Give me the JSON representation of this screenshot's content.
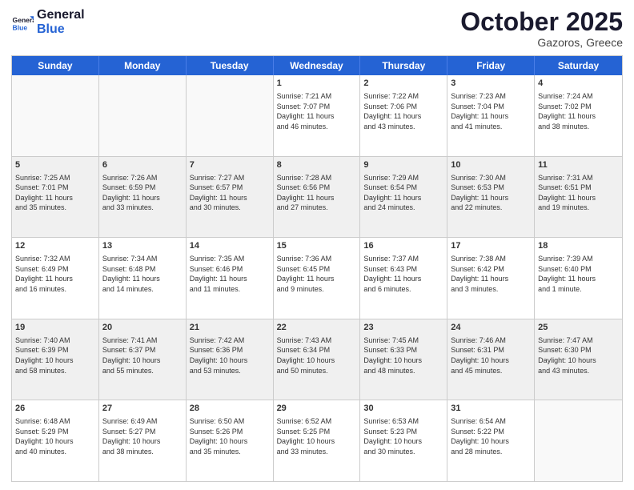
{
  "header": {
    "logo_general": "General",
    "logo_blue": "Blue",
    "month_title": "October 2025",
    "subtitle": "Gazoros, Greece"
  },
  "days_of_week": [
    "Sunday",
    "Monday",
    "Tuesday",
    "Wednesday",
    "Thursday",
    "Friday",
    "Saturday"
  ],
  "rows": [
    {
      "shaded": false,
      "cells": [
        {
          "day": "",
          "empty": true,
          "lines": []
        },
        {
          "day": "",
          "empty": true,
          "lines": []
        },
        {
          "day": "",
          "empty": true,
          "lines": []
        },
        {
          "day": "1",
          "empty": false,
          "lines": [
            "Sunrise: 7:21 AM",
            "Sunset: 7:07 PM",
            "Daylight: 11 hours",
            "and 46 minutes."
          ]
        },
        {
          "day": "2",
          "empty": false,
          "lines": [
            "Sunrise: 7:22 AM",
            "Sunset: 7:06 PM",
            "Daylight: 11 hours",
            "and 43 minutes."
          ]
        },
        {
          "day": "3",
          "empty": false,
          "lines": [
            "Sunrise: 7:23 AM",
            "Sunset: 7:04 PM",
            "Daylight: 11 hours",
            "and 41 minutes."
          ]
        },
        {
          "day": "4",
          "empty": false,
          "lines": [
            "Sunrise: 7:24 AM",
            "Sunset: 7:02 PM",
            "Daylight: 11 hours",
            "and 38 minutes."
          ]
        }
      ]
    },
    {
      "shaded": true,
      "cells": [
        {
          "day": "5",
          "empty": false,
          "lines": [
            "Sunrise: 7:25 AM",
            "Sunset: 7:01 PM",
            "Daylight: 11 hours",
            "and 35 minutes."
          ]
        },
        {
          "day": "6",
          "empty": false,
          "lines": [
            "Sunrise: 7:26 AM",
            "Sunset: 6:59 PM",
            "Daylight: 11 hours",
            "and 33 minutes."
          ]
        },
        {
          "day": "7",
          "empty": false,
          "lines": [
            "Sunrise: 7:27 AM",
            "Sunset: 6:57 PM",
            "Daylight: 11 hours",
            "and 30 minutes."
          ]
        },
        {
          "day": "8",
          "empty": false,
          "lines": [
            "Sunrise: 7:28 AM",
            "Sunset: 6:56 PM",
            "Daylight: 11 hours",
            "and 27 minutes."
          ]
        },
        {
          "day": "9",
          "empty": false,
          "lines": [
            "Sunrise: 7:29 AM",
            "Sunset: 6:54 PM",
            "Daylight: 11 hours",
            "and 24 minutes."
          ]
        },
        {
          "day": "10",
          "empty": false,
          "lines": [
            "Sunrise: 7:30 AM",
            "Sunset: 6:53 PM",
            "Daylight: 11 hours",
            "and 22 minutes."
          ]
        },
        {
          "day": "11",
          "empty": false,
          "lines": [
            "Sunrise: 7:31 AM",
            "Sunset: 6:51 PM",
            "Daylight: 11 hours",
            "and 19 minutes."
          ]
        }
      ]
    },
    {
      "shaded": false,
      "cells": [
        {
          "day": "12",
          "empty": false,
          "lines": [
            "Sunrise: 7:32 AM",
            "Sunset: 6:49 PM",
            "Daylight: 11 hours",
            "and 16 minutes."
          ]
        },
        {
          "day": "13",
          "empty": false,
          "lines": [
            "Sunrise: 7:34 AM",
            "Sunset: 6:48 PM",
            "Daylight: 11 hours",
            "and 14 minutes."
          ]
        },
        {
          "day": "14",
          "empty": false,
          "lines": [
            "Sunrise: 7:35 AM",
            "Sunset: 6:46 PM",
            "Daylight: 11 hours",
            "and 11 minutes."
          ]
        },
        {
          "day": "15",
          "empty": false,
          "lines": [
            "Sunrise: 7:36 AM",
            "Sunset: 6:45 PM",
            "Daylight: 11 hours",
            "and 9 minutes."
          ]
        },
        {
          "day": "16",
          "empty": false,
          "lines": [
            "Sunrise: 7:37 AM",
            "Sunset: 6:43 PM",
            "Daylight: 11 hours",
            "and 6 minutes."
          ]
        },
        {
          "day": "17",
          "empty": false,
          "lines": [
            "Sunrise: 7:38 AM",
            "Sunset: 6:42 PM",
            "Daylight: 11 hours",
            "and 3 minutes."
          ]
        },
        {
          "day": "18",
          "empty": false,
          "lines": [
            "Sunrise: 7:39 AM",
            "Sunset: 6:40 PM",
            "Daylight: 11 hours",
            "and 1 minute."
          ]
        }
      ]
    },
    {
      "shaded": true,
      "cells": [
        {
          "day": "19",
          "empty": false,
          "lines": [
            "Sunrise: 7:40 AM",
            "Sunset: 6:39 PM",
            "Daylight: 10 hours",
            "and 58 minutes."
          ]
        },
        {
          "day": "20",
          "empty": false,
          "lines": [
            "Sunrise: 7:41 AM",
            "Sunset: 6:37 PM",
            "Daylight: 10 hours",
            "and 55 minutes."
          ]
        },
        {
          "day": "21",
          "empty": false,
          "lines": [
            "Sunrise: 7:42 AM",
            "Sunset: 6:36 PM",
            "Daylight: 10 hours",
            "and 53 minutes."
          ]
        },
        {
          "day": "22",
          "empty": false,
          "lines": [
            "Sunrise: 7:43 AM",
            "Sunset: 6:34 PM",
            "Daylight: 10 hours",
            "and 50 minutes."
          ]
        },
        {
          "day": "23",
          "empty": false,
          "lines": [
            "Sunrise: 7:45 AM",
            "Sunset: 6:33 PM",
            "Daylight: 10 hours",
            "and 48 minutes."
          ]
        },
        {
          "day": "24",
          "empty": false,
          "lines": [
            "Sunrise: 7:46 AM",
            "Sunset: 6:31 PM",
            "Daylight: 10 hours",
            "and 45 minutes."
          ]
        },
        {
          "day": "25",
          "empty": false,
          "lines": [
            "Sunrise: 7:47 AM",
            "Sunset: 6:30 PM",
            "Daylight: 10 hours",
            "and 43 minutes."
          ]
        }
      ]
    },
    {
      "shaded": false,
      "cells": [
        {
          "day": "26",
          "empty": false,
          "lines": [
            "Sunrise: 6:48 AM",
            "Sunset: 5:29 PM",
            "Daylight: 10 hours",
            "and 40 minutes."
          ]
        },
        {
          "day": "27",
          "empty": false,
          "lines": [
            "Sunrise: 6:49 AM",
            "Sunset: 5:27 PM",
            "Daylight: 10 hours",
            "and 38 minutes."
          ]
        },
        {
          "day": "28",
          "empty": false,
          "lines": [
            "Sunrise: 6:50 AM",
            "Sunset: 5:26 PM",
            "Daylight: 10 hours",
            "and 35 minutes."
          ]
        },
        {
          "day": "29",
          "empty": false,
          "lines": [
            "Sunrise: 6:52 AM",
            "Sunset: 5:25 PM",
            "Daylight: 10 hours",
            "and 33 minutes."
          ]
        },
        {
          "day": "30",
          "empty": false,
          "lines": [
            "Sunrise: 6:53 AM",
            "Sunset: 5:23 PM",
            "Daylight: 10 hours",
            "and 30 minutes."
          ]
        },
        {
          "day": "31",
          "empty": false,
          "lines": [
            "Sunrise: 6:54 AM",
            "Sunset: 5:22 PM",
            "Daylight: 10 hours",
            "and 28 minutes."
          ]
        },
        {
          "day": "",
          "empty": true,
          "lines": []
        }
      ]
    }
  ]
}
